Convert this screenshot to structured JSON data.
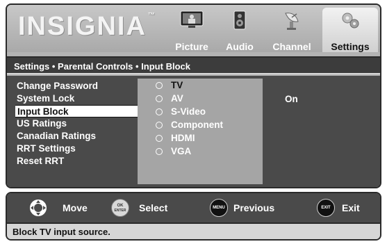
{
  "brand": {
    "logo": "INSIGNIA",
    "trademark": "™"
  },
  "tabs": [
    {
      "label": "Picture",
      "icon": "picture-icon",
      "active": false
    },
    {
      "label": "Audio",
      "icon": "speaker-icon",
      "active": false
    },
    {
      "label": "Channel",
      "icon": "satellite-dish-icon",
      "active": false
    },
    {
      "label": "Settings",
      "icon": "gears-icon",
      "active": true
    }
  ],
  "breadcrumb": "Settings • Parental Controls • Input Block",
  "menu": {
    "items": [
      {
        "label": "Change Password",
        "selected": false
      },
      {
        "label": "System Lock",
        "selected": false
      },
      {
        "label": "Input Block",
        "selected": true
      },
      {
        "label": "US Ratings",
        "selected": false
      },
      {
        "label": "Canadian Ratings",
        "selected": false
      },
      {
        "label": "RRT Settings",
        "selected": false
      },
      {
        "label": "Reset RRT",
        "selected": false
      }
    ]
  },
  "options": [
    {
      "label": "TV",
      "active": true
    },
    {
      "label": "AV",
      "active": false
    },
    {
      "label": "S-Video",
      "active": false
    },
    {
      "label": "Component",
      "active": false
    },
    {
      "label": "HDMI",
      "active": false
    },
    {
      "label": "VGA",
      "active": false
    }
  ],
  "state_value": "On",
  "nav": {
    "move_label": "Move",
    "select_label": "Select",
    "select_icon_top": "OK",
    "select_icon_bottom": "ENTER",
    "previous_label": "Previous",
    "previous_icon": "MENU",
    "exit_label": "Exit",
    "exit_icon": "EXIT"
  },
  "description": "Block TV input source.",
  "colors": {
    "panel_bg": "#b3b3b3",
    "menu_bg": "#4a4a4a",
    "options_bg": "#a5a5a5",
    "text_light": "#ffffff",
    "text_dark": "#111111"
  }
}
